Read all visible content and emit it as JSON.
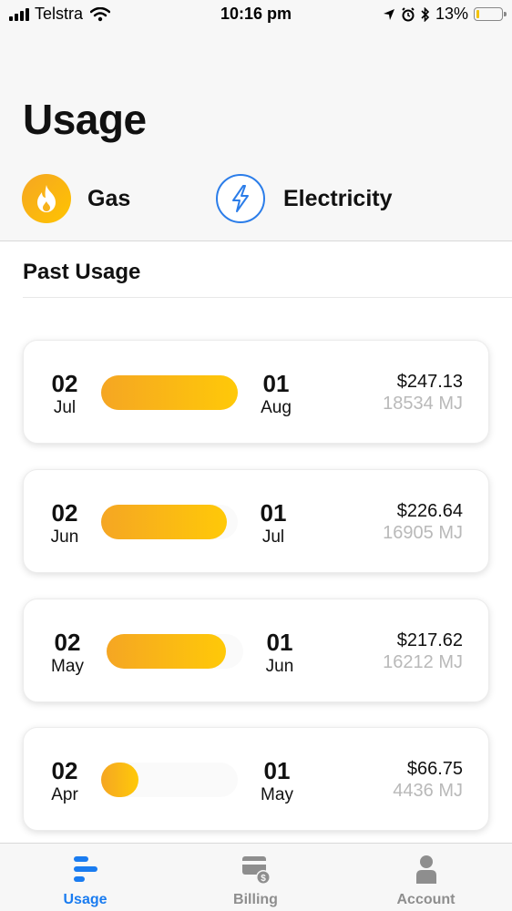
{
  "status_bar": {
    "carrier": "Telstra",
    "time": "10:16 pm",
    "battery_percent": "13%",
    "battery_level": 0.13
  },
  "header": {
    "title": "Usage",
    "utilities": [
      {
        "label": "Gas",
        "icon": "flame-icon",
        "color": "#f5a623"
      },
      {
        "label": "Electricity",
        "icon": "lightning-icon",
        "color": "#2b7de9"
      }
    ]
  },
  "section": {
    "title": "Past Usage"
  },
  "usage_periods": [
    {
      "start_day": "02",
      "start_month": "Jul",
      "end_day": "01",
      "end_month": "Aug",
      "amount": "$247.13",
      "energy": "18534 MJ",
      "fill_fraction": 1.0
    },
    {
      "start_day": "02",
      "start_month": "Jun",
      "end_day": "01",
      "end_month": "Jul",
      "amount": "$226.64",
      "energy": "16905 MJ",
      "fill_fraction": 0.92
    },
    {
      "start_day": "02",
      "start_month": "May",
      "end_day": "01",
      "end_month": "Jun",
      "amount": "$217.62",
      "energy": "16212 MJ",
      "fill_fraction": 0.87
    },
    {
      "start_day": "02",
      "start_month": "Apr",
      "end_day": "01",
      "end_month": "May",
      "amount": "$66.75",
      "energy": "4436 MJ",
      "fill_fraction": 0.27
    }
  ],
  "tab_bar": {
    "active_color": "#1a7cf0",
    "inactive_color": "#8e8e8e",
    "tabs": [
      {
        "label": "Usage",
        "icon": "usage-bars-icon",
        "active": true
      },
      {
        "label": "Billing",
        "icon": "billing-card-icon",
        "active": false
      },
      {
        "label": "Account",
        "icon": "person-icon",
        "active": false
      }
    ]
  },
  "accent": {
    "gas_gradient_start": "#f5a623",
    "gas_gradient_end": "#ffc908"
  }
}
